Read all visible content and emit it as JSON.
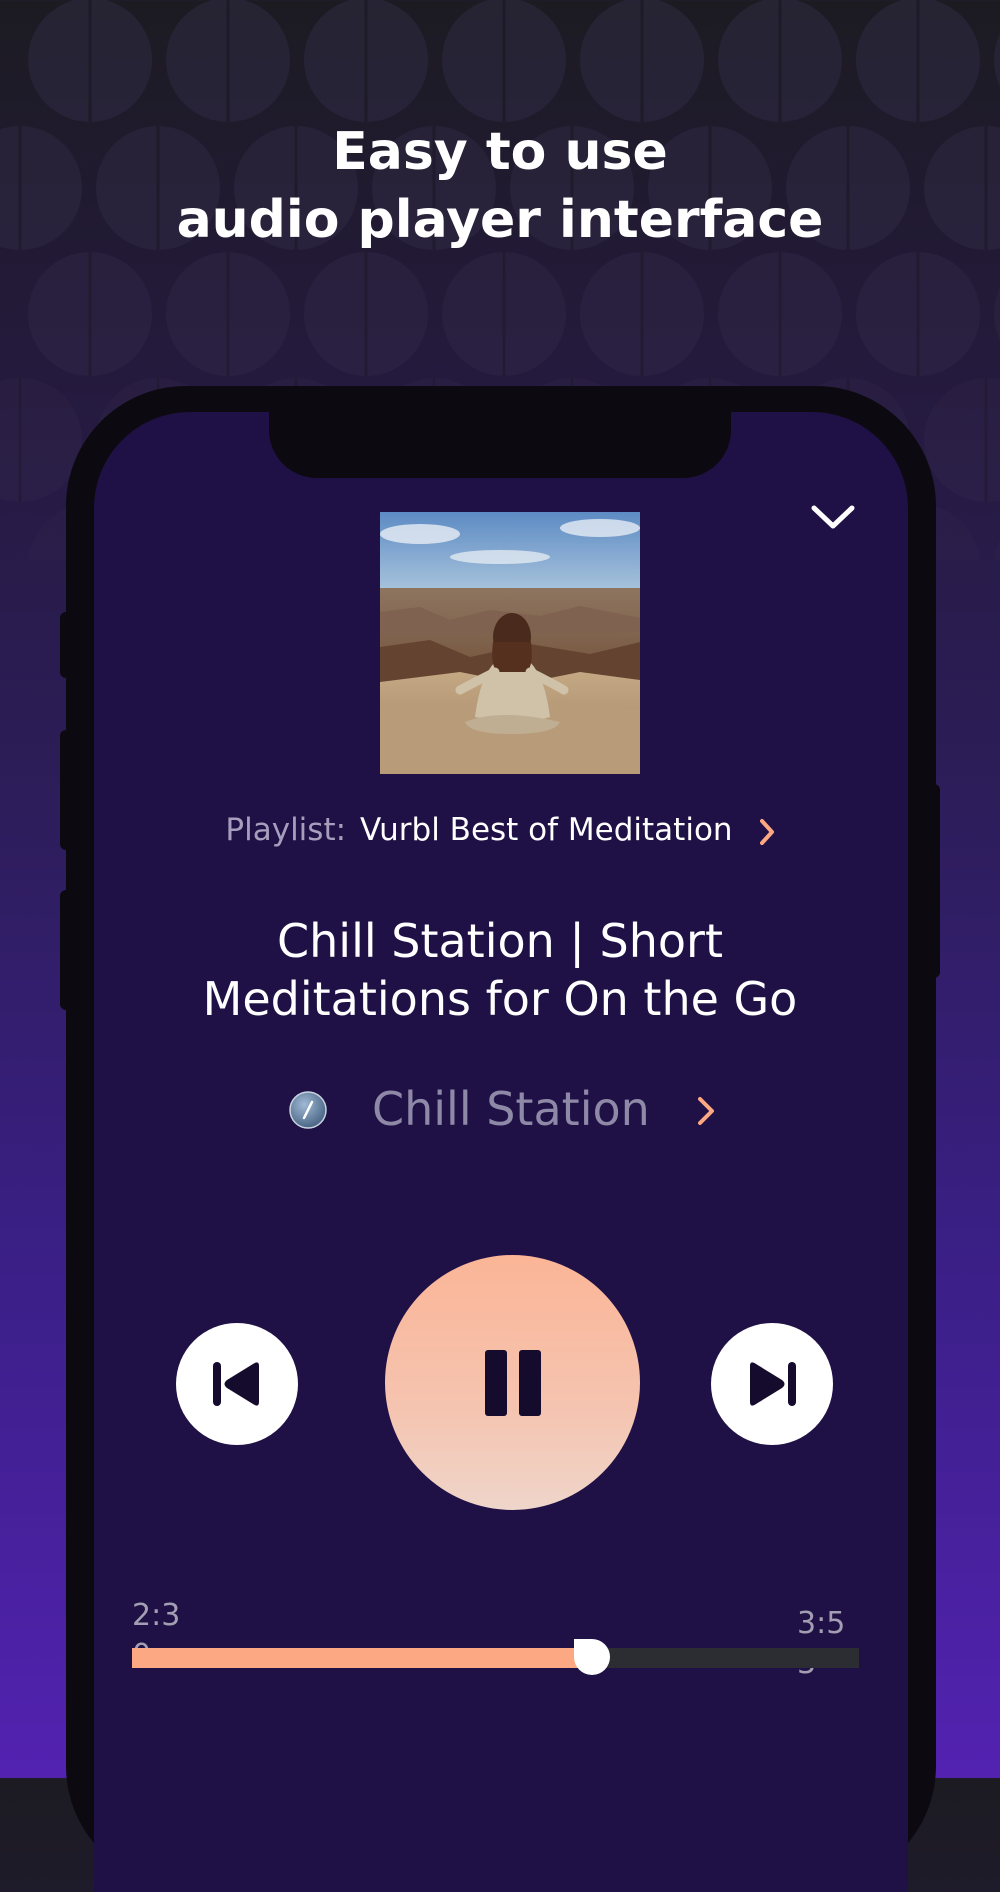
{
  "headline": {
    "line1": "Easy to use",
    "line2": "audio player interface"
  },
  "player": {
    "collapse_icon": "chevron-down-icon",
    "artwork": "person meditating on canyon rim photo",
    "playlist_label": "Playlist:",
    "playlist_name": "Vurbl Best of Meditation",
    "episode_title_line1": "Chill Station | Short",
    "episode_title_line2": "Meditations for On the Go",
    "podcast_name": "Chill Station",
    "controls": {
      "previous_icon": "skip-previous-icon",
      "pause_icon": "pause-icon",
      "next_icon": "skip-next-icon"
    },
    "progress": {
      "elapsed": "2:30",
      "total": "3:53",
      "fraction": 0.63
    }
  },
  "colors": {
    "accent": "#fca882",
    "screen_bg": "#1f1045",
    "play_button": "#f8bea4"
  }
}
